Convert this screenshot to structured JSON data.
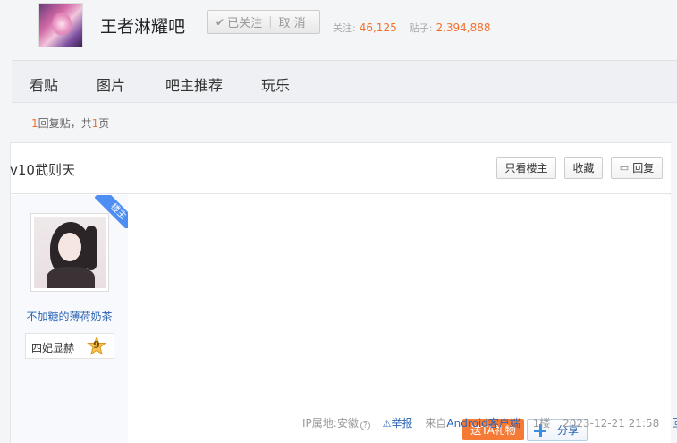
{
  "forum": {
    "name": "王者淋耀吧",
    "follow_label": "已关注",
    "cancel_label": "取 消",
    "follow_count_label": "关注:",
    "follow_count": "46,125",
    "post_count_label": "贴子:",
    "post_count": "2,394,888"
  },
  "nav": {
    "tabs": [
      "看贴",
      "图片",
      "吧主推荐",
      "玩乐"
    ]
  },
  "thread_info": {
    "reply_num": "1",
    "reply_text": "回复贴，共",
    "page_num": "1",
    "page_text": "页"
  },
  "post": {
    "title": "v10武则天",
    "buttons": {
      "only_op": "只看楼主",
      "favorite": "收藏",
      "reply": "回复"
    },
    "author": {
      "name": "不加糖的薄荷奶茶",
      "level_title": "四妃显赫",
      "level_num": "9",
      "badge": "楼主"
    },
    "actions": {
      "gift": "送TA礼物",
      "share": "分享"
    },
    "tail": {
      "ip": "IP属地:安徽",
      "report": "举报",
      "source": "来自Android客户端",
      "floor": "1楼",
      "time": "2023-12-21 21:58",
      "reply": "回复"
    }
  },
  "colors": {
    "accent_orange": "#f4702d",
    "link_blue": "#2d64b3",
    "badge_blue": "#4e8ef2",
    "gift_orange": "#f47a36"
  },
  "icons": {
    "follow_check": "check-icon",
    "reply": "comment-icon",
    "share": "plus-icon",
    "report": "warning-icon",
    "help": "question-icon"
  }
}
